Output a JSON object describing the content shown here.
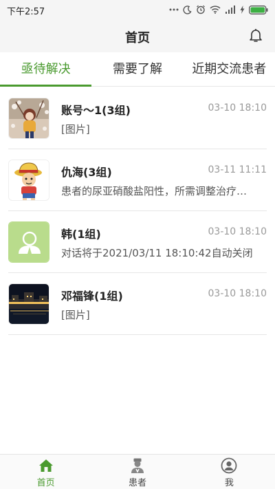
{
  "status_bar": {
    "time": "下午2:57"
  },
  "header": {
    "title": "首页"
  },
  "tabs": [
    {
      "label": "亟待解决",
      "active": true
    },
    {
      "label": "需要了解",
      "active": false
    },
    {
      "label": "近期交流患者",
      "active": false
    }
  ],
  "conversations": [
    {
      "name": "账号～1(3组)",
      "time": "03-10 18:10",
      "message": "[图片]",
      "avatar": "anime-girl-photo"
    },
    {
      "name": "仇海(3组)",
      "time": "03-11 11:11",
      "message": "患者的尿亚硝酸盐阳性，所需调整治疗…",
      "avatar": "cartoon-boy-straw-hat"
    },
    {
      "name": "韩(1组)",
      "time": "03-10 18:10",
      "message": "对话将于2021/03/11 18:10:42自动关闭",
      "avatar": "default-user-placeholder"
    },
    {
      "name": "邓福锋(1组)",
      "time": "03-10 18:10",
      "message": "[图片]",
      "avatar": "night-cityscape-photo"
    }
  ],
  "bottom_nav": [
    {
      "label": "首页",
      "icon": "home-icon",
      "active": true
    },
    {
      "label": "患者",
      "icon": "doctor-icon",
      "active": false
    },
    {
      "label": "我",
      "icon": "profile-icon",
      "active": false
    }
  ],
  "colors": {
    "accent": "#4a9a2f",
    "placeholder_avatar_bg": "#b9dc8c"
  }
}
